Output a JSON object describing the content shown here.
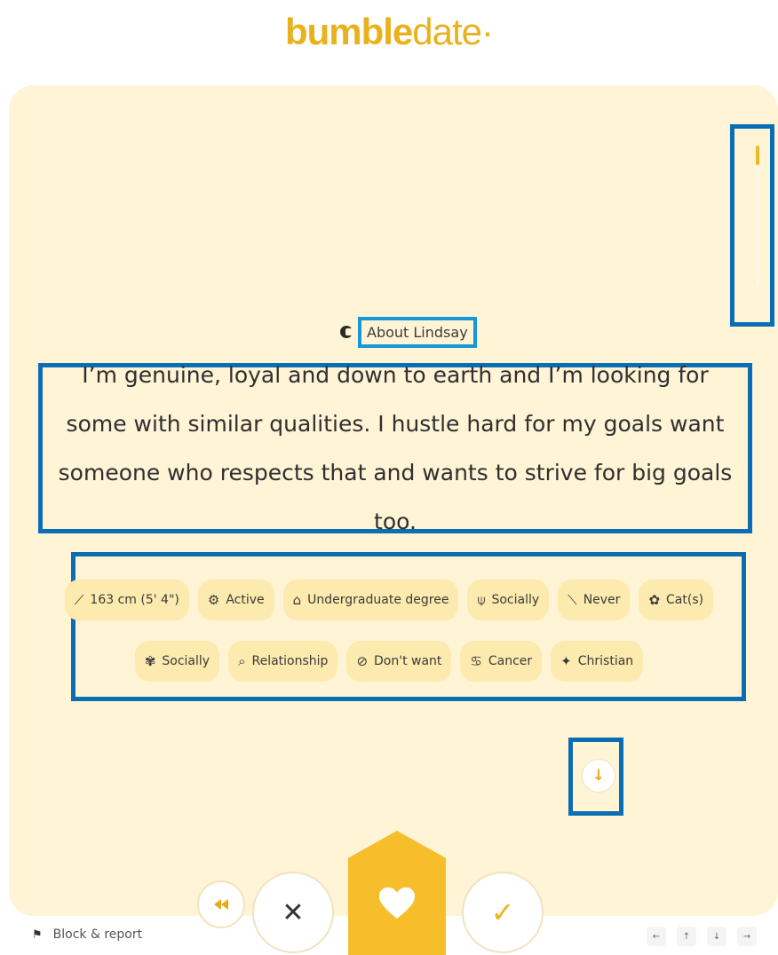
{
  "logo": {
    "part1": "bumble",
    "part2": "date",
    "dot": "·"
  },
  "about": {
    "label": "About Lindsay",
    "icon": "chat-bubble-icon"
  },
  "bio": "I’m genuine, loyal and down to earth and I’m looking for some with similar qualities. I hustle hard for my goals want someone who respects that and wants to strive for big goals too.",
  "chips_row1": [
    {
      "icon": "ruler-icon",
      "glyph": "⟋",
      "label": "163 cm (5' 4\")"
    },
    {
      "icon": "dumbbell-icon",
      "glyph": "⚙",
      "label": "Active"
    },
    {
      "icon": "graduation-cap-icon",
      "glyph": "⌂",
      "label": "Undergraduate degree"
    },
    {
      "icon": "wine-glass-icon",
      "glyph": "⍦",
      "label": "Socially"
    },
    {
      "icon": "smoking-icon",
      "glyph": "⟍",
      "label": "Never"
    },
    {
      "icon": "pet-paw-icon",
      "glyph": "✿",
      "label": "Cat(s)"
    }
  ],
  "chips_row2": [
    {
      "icon": "cannabis-icon",
      "glyph": "✾",
      "label": "Socially"
    },
    {
      "icon": "search-icon",
      "glyph": "⌕",
      "label": "Relationship"
    },
    {
      "icon": "children-icon",
      "glyph": "⊘",
      "label": "Don't want"
    },
    {
      "icon": "zodiac-icon",
      "glyph": "♋",
      "label": "Cancer"
    },
    {
      "icon": "religion-icon",
      "glyph": "✦",
      "label": "Christian"
    }
  ],
  "actions": {
    "rewind_icon": "rewind-icon",
    "pass_glyph": "✕",
    "like_icon": "heart-icon",
    "accept_glyph": "✓",
    "scroll_down_glyph": "↓"
  },
  "footer": {
    "report_label": "Block & report",
    "keys": [
      "←",
      "↑",
      "↓",
      "→"
    ]
  },
  "colors": {
    "accent": "#f6be2b",
    "card_bg": "#fff4d6",
    "chip_bg": "#fdeaae",
    "highlight": "#0b6db3"
  }
}
